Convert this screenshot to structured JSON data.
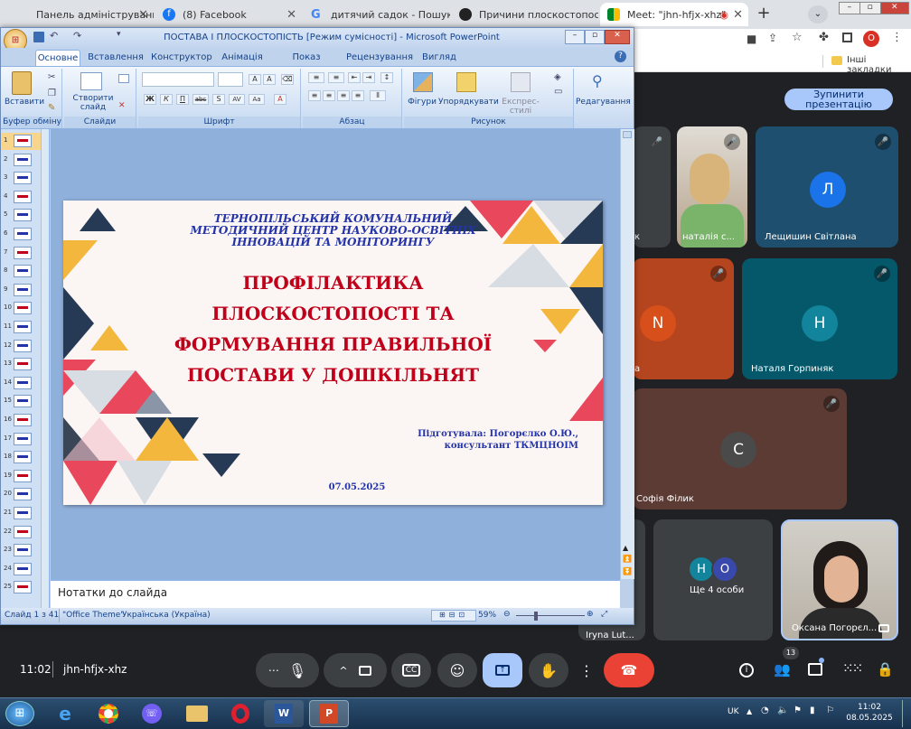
{
  "browser": {
    "tabs": [
      {
        "title": "Панель адміністрування"
      },
      {
        "title": "(8) Facebook"
      },
      {
        "title": "дитячий садок - Пошук Goo"
      },
      {
        "title": "Причини плоскостопості та"
      },
      {
        "title": "Meet: \"jhn-hfjx-xhz\""
      }
    ],
    "bookmarks": "Інші закладки",
    "profile_initial": "O"
  },
  "ppt": {
    "window_title": "ПОСТАВА І ПЛОСКОСТОПІСТЬ [Режим сумісності] - Microsoft PowerPoint",
    "tabs": [
      "Основне",
      "Вставлення",
      "Конструктор",
      "Анімація",
      "Показ слайдів",
      "Рецензування",
      "Вигляд"
    ],
    "ribbon": {
      "paste": "Вставити",
      "clipboard": "Буфер обміну",
      "new_slide": "Створити слайд",
      "slides": "Слайди",
      "font": "Шрифт",
      "paragraph": "Абзац",
      "shapes": "Фігури",
      "arrange": "Упорядкувати",
      "quick_styles": "Експрес-стилі",
      "drawing": "Рисунок",
      "editing": "Редагування",
      "bold": "Ж",
      "italic": "К",
      "underline": "П",
      "strike": "abc",
      "shadow": "S",
      "spacing": "AV",
      "case": "Aa"
    },
    "slide_numbers": [
      "1",
      "2",
      "3",
      "4",
      "5",
      "6",
      "7",
      "8",
      "9",
      "10",
      "11",
      "12",
      "13",
      "14",
      "15",
      "16",
      "17",
      "18",
      "19",
      "20",
      "21",
      "22",
      "23",
      "24",
      "25"
    ],
    "slide": {
      "org": [
        "ТЕРНОПІЛЬСЬКИЙ КОМУНАЛЬНИЙ",
        "МЕТОДИЧНИЙ ЦЕНТР НАУКОВО-ОСВІТНІХ",
        "ІННОВАЦІЙ ТА МОНІТОРИНГУ"
      ],
      "title": [
        "ПРОФІЛАКТИКА",
        "ПЛОСКОСТОПОСТІ ТА",
        "ФОРМУВАННЯ ПРАВИЛЬНОЇ",
        "ПОСТАВИ У ДОШКІЛЬНЯТ"
      ],
      "author1": "Підготувала:  Погорєлко О.Ю.,",
      "author2": "консультант ТКМЦНОІМ",
      "date": "07.05.2025"
    },
    "notes": "Нотатки до слайда",
    "status": {
      "slide": "Слайд 1 з 41",
      "theme": "\"Office Theme\"",
      "lang": "Українська (Україна)",
      "zoom": "59%"
    }
  },
  "meet": {
    "stop_line1": "Зупинити",
    "stop_line2": "презентацію",
    "participants": [
      {
        "name": "наталія с...",
        "initial": ""
      },
      {
        "name": "Лещишин Світлана",
        "initial": "Л"
      },
      {
        "name": "",
        "initial": "N"
      },
      {
        "name": "Наталя Горпиняк",
        "initial": "Н"
      },
      {
        "name": "Софія Філик",
        "initial": "С"
      },
      {
        "name": "Ще 4 особи",
        "initial": "Н"
      },
      {
        "name": "Оксана Погорєл...",
        "initial": ""
      },
      {
        "name": "Iryna Lut...",
        "initial": ""
      }
    ],
    "more_second": "О",
    "meeting_time": "11:02",
    "meeting_code": "jhn-hfjx-xhz",
    "people_count": "13"
  },
  "taskbar": {
    "time": "11:02",
    "date": "08.05.2025",
    "lang": "UK"
  },
  "colors": {
    "ppt_blue": "#15428b",
    "slide_red": "#c0001a",
    "slide_blue": "#2433a8",
    "meet_end": "#ea4335"
  }
}
